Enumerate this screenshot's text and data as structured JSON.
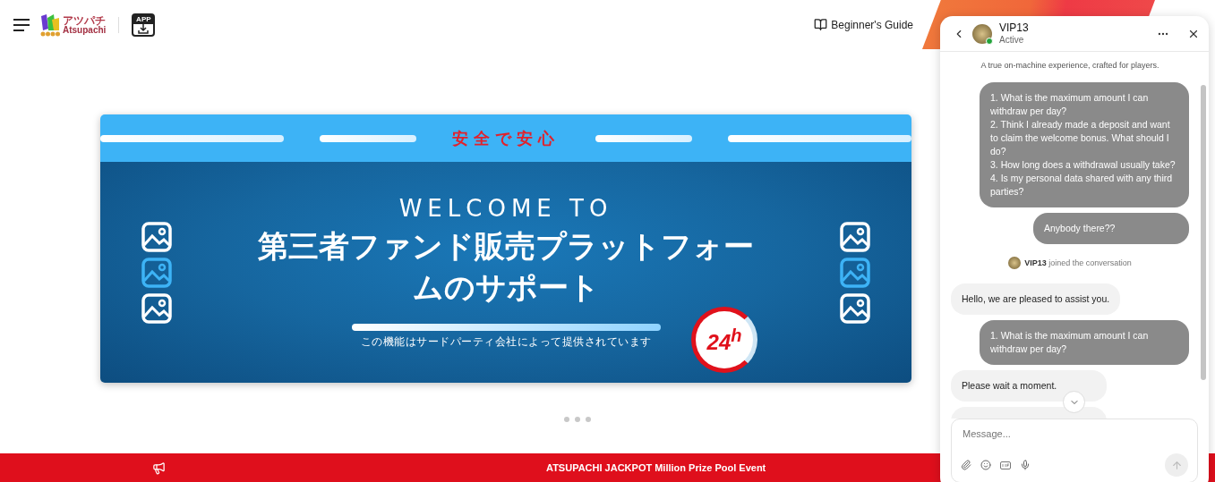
{
  "header": {
    "guide_link": "Beginner's Guide",
    "logo": {
      "kana": "アツパチ",
      "latin": "Atsupachi"
    },
    "app_badge": "APP"
  },
  "banner": {
    "top_title": "安全で安心",
    "welcome": "WELCOME TO",
    "headline": "第三者ファンド販売プラットフォームのサポート",
    "clock_badge": "24$^{h}$",
    "caption": "この機能はサードパーティ会社によって提供されています"
  },
  "carousel": {
    "dots": [
      {
        "selected": false
      },
      {
        "selected": false
      },
      {
        "selected": false
      }
    ]
  },
  "ticker": {
    "text": "ATSUPACHI JACKPOT Million Prize Pool Event"
  },
  "chat": {
    "agent_name": "VIP13",
    "status": "Active",
    "online": true,
    "messages": [
      {
        "kind": "note",
        "text": "A true on-machine experience, crafted for players."
      },
      {
        "kind": "user",
        "lines": [
          "1. What is the maximum amount I can withdraw per day?",
          "2. Think I already made a deposit and want to claim the welcome bonus. What should I do?",
          "3. How long does a withdrawal usually take?",
          "4. Is my personal data shared with any third parties?"
        ]
      },
      {
        "kind": "user",
        "lines": [
          "Anybody there??"
        ]
      },
      {
        "kind": "join",
        "name": "VIP13",
        "text": "joined the conversation"
      },
      {
        "kind": "agent",
        "lines": [
          "Hello, we are pleased to assist you."
        ]
      },
      {
        "kind": "user",
        "lines": [
          "1. What is the maximum amount I can withdraw per day?"
        ]
      },
      {
        "kind": "agent",
        "lines": [
          "Please wait a moment."
        ]
      },
      {
        "kind": "agent"
      }
    ],
    "input": {
      "placeholder": "Message..."
    }
  }
}
